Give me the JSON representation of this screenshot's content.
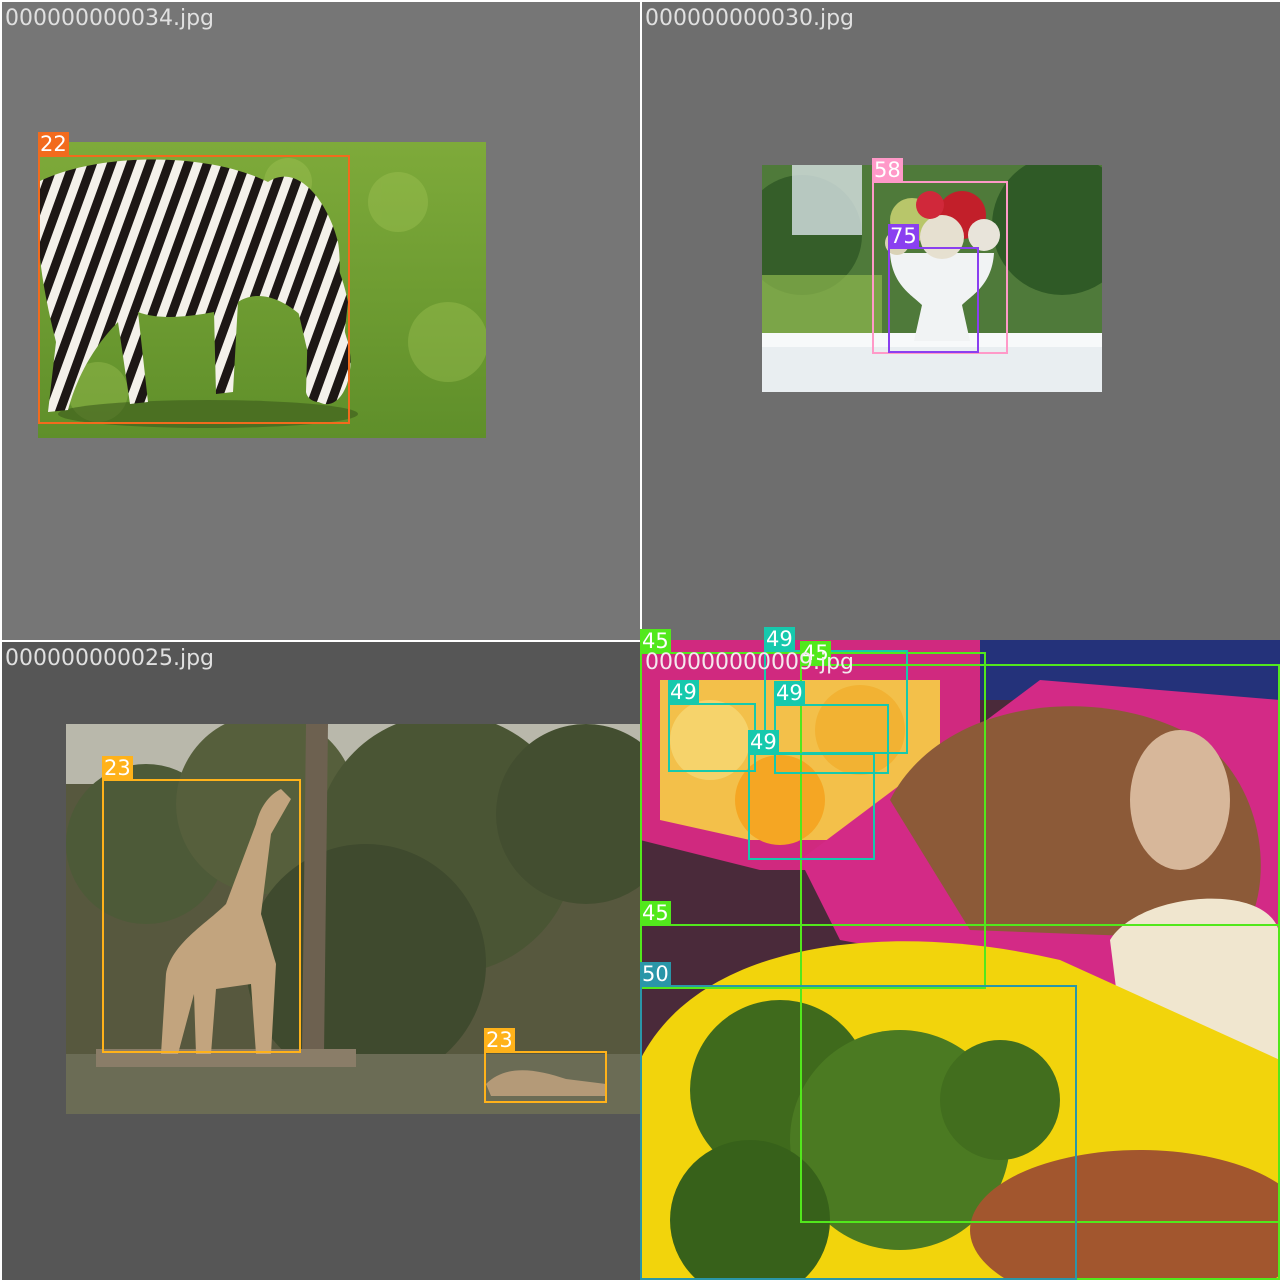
{
  "tiles": [
    {
      "filename": "000000000034.jpg",
      "detections": [
        {
          "class_id": "22",
          "color": "#f26b1d"
        }
      ]
    },
    {
      "filename": "000000000030.jpg",
      "detections": [
        {
          "class_id": "58",
          "color": "#ff99c8"
        },
        {
          "class_id": "75",
          "color": "#8a3ff0"
        }
      ]
    },
    {
      "filename": "000000000025.jpg",
      "detections": [
        {
          "class_id": "23",
          "color": "#ffb21a"
        },
        {
          "class_id": "23",
          "color": "#ffb21a"
        }
      ]
    },
    {
      "filename": "000000000009.jpg",
      "detections": [
        {
          "class_id": "45",
          "color": "#52e81c"
        },
        {
          "class_id": "49",
          "color": "#16c9ad"
        },
        {
          "class_id": "45",
          "color": "#52e81c"
        },
        {
          "class_id": "49",
          "color": "#16c9ad"
        },
        {
          "class_id": "49",
          "color": "#16c9ad"
        },
        {
          "class_id": "49",
          "color": "#16c9ad"
        },
        {
          "class_id": "45",
          "color": "#52e81c"
        },
        {
          "class_id": "50",
          "color": "#2a96a8"
        }
      ]
    }
  ]
}
